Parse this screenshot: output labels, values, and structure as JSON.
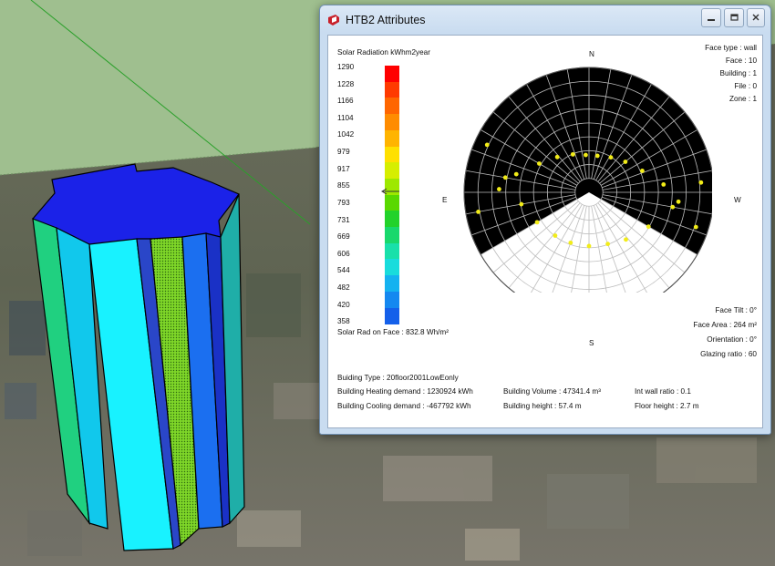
{
  "window": {
    "title": "HTB2 Attributes",
    "app_icon": "sketchup-logo-icon",
    "controls": [
      "minimize-icon",
      "restore-icon",
      "close-icon"
    ]
  },
  "scale": {
    "title": "Solar Radiation kWhm2year",
    "ticks": [
      "1290",
      "1228",
      "1166",
      "1104",
      "1042",
      "979",
      "917",
      "855",
      "793",
      "731",
      "669",
      "606",
      "544",
      "482",
      "420",
      "358"
    ],
    "colors": [
      "#ff0000",
      "#ff3a00",
      "#ff6600",
      "#ff8c00",
      "#ffb400",
      "#ffe000",
      "#d6ee00",
      "#9ee800",
      "#5ad800",
      "#22d22a",
      "#18d86c",
      "#18e0aa",
      "#18dcdc",
      "#14b2f0",
      "#1488f0",
      "#1460ea"
    ],
    "solar_rad_on_face": "Solar Rad on Face : 832.8 Wh/m²"
  },
  "compass": {
    "n": "N",
    "e": "E",
    "w": "W",
    "s": "S"
  },
  "face_info": {
    "face_type": "Face type : wall",
    "face": "Face : 10",
    "building": "Building : 1",
    "file": "File : 0",
    "zone": "Zone : 1"
  },
  "face_geom": {
    "tilt": "Face Tilt : 0°",
    "area": "Face Area : 264 m²",
    "orientation": "Orientation : 0°",
    "glazing": "Glazing ratio : 60"
  },
  "building": {
    "type": "Buiding Type : 20floor2001LowEonly",
    "heating": "Building Heating demand : 1230924 kWh",
    "cooling": "Building Cooling demand : -467792 kWh",
    "volume": "Building Volume : 47341.4 m³",
    "height": "Building height : 57.4 m",
    "int_wall": "Int wall ratio : 0.1",
    "floor_height": "Floor height : 2.7 m"
  }
}
